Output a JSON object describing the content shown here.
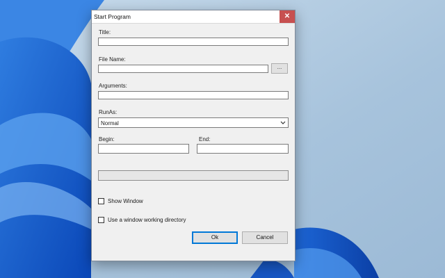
{
  "dialog": {
    "title": "Start Program",
    "close_glyph": "✕",
    "title_label": "Title:",
    "title_value": "",
    "filename_label": "File Name:",
    "filename_value": "",
    "browse_label": "...",
    "arguments_label": "Arguments:",
    "arguments_value": "",
    "runas_label": "RunAs:",
    "runas_value": "Normal",
    "begin_label": "Begin:",
    "begin_value": "",
    "end_label": "End:",
    "end_value": "",
    "progress_fraction": 0,
    "show_window_label": "Show Window",
    "show_window_checked": false,
    "working_dir_label": "Use a window working directory",
    "working_dir_checked": false,
    "ok_label": "Ok",
    "cancel_label": "Cancel"
  },
  "colors": {
    "close_button": "#c75050",
    "dialog_bg": "#f0f0f0",
    "wallpaper": "#a9c4dc",
    "accent": "#0078d7"
  }
}
